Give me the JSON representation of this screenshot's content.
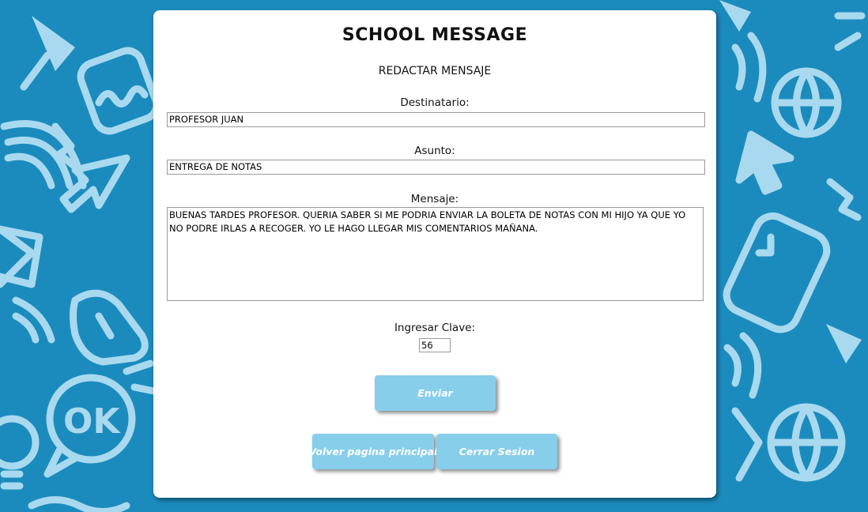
{
  "page": {
    "title": "SCHOOL MESSAGE",
    "subtitle": "REDACTAR MENSAJE"
  },
  "form": {
    "recipient": {
      "label": "Destinatario:",
      "value": "PROFESOR JUAN"
    },
    "subject": {
      "label": "Asunto:",
      "value": "ENTREGA DE NOTAS"
    },
    "message": {
      "label": "Mensaje:",
      "value": "BUENAS TARDES PROFESOR. QUERIA SABER SI ME PODRIA ENVIAR LA BOLETA DE NOTAS CON MI HIJO YA QUE YO NO PODRE IRLAS A RECOGER. YO LE HAGO LLEGAR MIS COMENTARIOS MAÑANA."
    },
    "password": {
      "label": "Ingresar Clave:",
      "value": "56"
    }
  },
  "buttons": {
    "send": "Enviar",
    "home": "Volver pagina principal",
    "logout": "Cerrar Sesion"
  },
  "colors": {
    "background": "#1b8bbd",
    "doodle": "#a9d9ef",
    "button": "#87ceeb",
    "card": "#ffffff"
  },
  "icons": {
    "background": [
      "enter-key-icon",
      "cursor-arrow-icon",
      "wifi-icon",
      "ok-speech-bubble-icon",
      "pointing-hand-icon",
      "globe-icon",
      "envelope-icon",
      "pushpin-icon",
      "lightbulb-icon"
    ]
  }
}
